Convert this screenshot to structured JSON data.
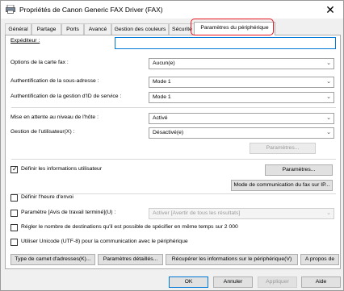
{
  "window": {
    "title": "Propriétés de Canon Generic FAX Driver (FAX)",
    "close_glyph": "✕"
  },
  "tabs": [
    {
      "label": "Général"
    },
    {
      "label": "Partage"
    },
    {
      "label": "Ports"
    },
    {
      "label": "Avancé"
    },
    {
      "label": "Gestion des couleurs"
    },
    {
      "label": "Sécurité"
    },
    {
      "label": "Paramètres du périphérique",
      "active": true
    }
  ],
  "fields": {
    "expediteur_label": "Expéditeur :",
    "expediteur_value": ""
  },
  "options": {
    "carte_fax_label": "Options de la carte fax :",
    "carte_fax_value": "Aucun(e)",
    "sous_adresse_label": "Authentification de la sous-adresse :",
    "sous_adresse_value": "Mode 1",
    "gestion_id_label": "Authentification de la gestion d'ID de service :",
    "gestion_id_value": "Mode 1",
    "mise_attente_label": "Mise en attente au niveau de l'hôte :",
    "mise_attente_value": "Activé",
    "gestion_utilisateur_label": "Gestion de l'utilisateur(X) :",
    "gestion_utilisateur_value": "Désactivé(e)",
    "parametres_disabled": "Paramètres..."
  },
  "user_info": {
    "definir_label": "Définir les informations utilisateur",
    "definir_checked": true,
    "parametres_button": "Paramètres...",
    "mode_comm_button": "Mode de communication du fax sur IP..."
  },
  "checkboxes": {
    "heure_envoi": "Définir l'heure d'envoi",
    "avis_travail": "Paramètre [Avis de travail terminé](U) :",
    "avis_value": "Activer [Avertir de tous les résultats]",
    "regler_nombre": "Régler le nombre de destinations qu'il est possible de spécifier en même temps sur 2 000",
    "unicode": "Utiliser Unicode (UTF-8) pour la communication avec le périphérique"
  },
  "bottom_buttons": {
    "type_carnet": "Type de carnet d'adresses(K)...",
    "parametres_detailles": "Paramètres détaillés...",
    "recuperer": "Récupérer les informations sur le périphérique(V)",
    "a_propos": "A propos de"
  },
  "footer": {
    "ok": "OK",
    "annuler": "Annuler",
    "appliquer": "Appliquer",
    "aide": "Aide"
  },
  "colors": {
    "focus_blue": "#0078d7",
    "highlight_red": "#e8141e"
  }
}
